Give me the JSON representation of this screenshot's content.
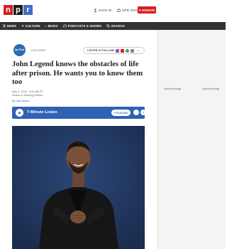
{
  "header": {
    "logo": [
      "n",
      "p",
      "r"
    ],
    "sign_in": "SIGN IN",
    "shop": "NPR SHOP",
    "donate": "DONATE"
  },
  "nav": {
    "items": [
      {
        "label": "NEWS",
        "icon": "menu-icon"
      },
      {
        "label": "CULTURE",
        "icon": "culture-icon"
      },
      {
        "label": "MUSIC",
        "icon": "music-note-icon"
      },
      {
        "label": "PODCASTS & SHOWS",
        "icon": "headphones-icon"
      },
      {
        "label": "SEARCH",
        "icon": "search-icon"
      }
    ]
  },
  "article": {
    "badge": "Up First",
    "category": "CULTURE",
    "listen_follow": "LISTEN & FOLLOW",
    "title": "John Legend knows the obstacles of life after prison. He wants you to know them too",
    "date": "May 4, 2023 · 5:00 AM ET",
    "heard_on": "Heard on Morning Edition",
    "byline": "By Lilly Quiroz"
  },
  "player": {
    "label": "7-Minute Listen",
    "playlist": "PLAYLIST",
    "accent": "#2f62b4"
  },
  "sidebar": {
    "ad_left": "Special Message",
    "ad_right": "Special Message"
  },
  "colors": {
    "brand_red": "#d62021",
    "nav_bg": "#333333",
    "photo_bg": "#1f3458"
  }
}
